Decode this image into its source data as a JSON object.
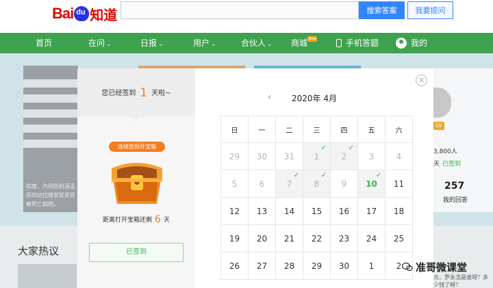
{
  "header": {
    "logo_text": "Bai",
    "logo_paw": "du",
    "logo_cn": "知道",
    "search_button": "搜索答案",
    "ask_button": "我要提问"
  },
  "nav": {
    "items": [
      "首页",
      "在问",
      "日报",
      "用户",
      "合伙人",
      "商城",
      "手机答题",
      "我的"
    ],
    "new_tag": "New"
  },
  "background": {
    "news_snippet": "印度，为何危机诬孟买的达拉维贫民贫民窟死亡病例。",
    "profile_level": "LV",
    "fans": "3,800人",
    "days_label": "天",
    "days_signed": "已签到",
    "answer_count": "257",
    "answer_label": "我的回答",
    "hot_title": "大家热议",
    "bottom_snippet": "元，罗永浩是谁呀？多少钱了呀？"
  },
  "modal": {
    "streak_prefix": "您已经签到",
    "streak_days": "1",
    "streak_suffix": "天啦~",
    "chest_badge": "连续签到开宝箱",
    "remain_prefix": "距离打开宝箱还剩",
    "remain_days": "6",
    "remain_suffix": "天",
    "signed_button": "已签到",
    "close": "×",
    "prev_arrow": "‹",
    "month": "2020年 4月"
  },
  "calendar": {
    "weekdays": [
      "日",
      "一",
      "二",
      "三",
      "四",
      "五",
      "六"
    ],
    "rows": [
      [
        {
          "d": "29",
          "t": "other"
        },
        {
          "d": "30",
          "t": "other"
        },
        {
          "d": "31",
          "t": "other"
        },
        {
          "d": "1",
          "t": "other",
          "signed": true
        },
        {
          "d": "2",
          "t": "other",
          "signed": true
        },
        {
          "d": "3",
          "t": "other"
        },
        {
          "d": "4",
          "t": "other"
        }
      ],
      [
        {
          "d": "5",
          "t": "other"
        },
        {
          "d": "6",
          "t": "other"
        },
        {
          "d": "7",
          "t": "other",
          "signed": true
        },
        {
          "d": "8",
          "t": "other",
          "signed": true
        },
        {
          "d": "9",
          "t": "other"
        },
        {
          "d": "10",
          "t": "today",
          "signed": true
        },
        {
          "d": "11",
          "t": "cur"
        }
      ],
      [
        {
          "d": "12",
          "t": "cur"
        },
        {
          "d": "13",
          "t": "cur"
        },
        {
          "d": "14",
          "t": "cur"
        },
        {
          "d": "15",
          "t": "cur"
        },
        {
          "d": "16",
          "t": "cur"
        },
        {
          "d": "17",
          "t": "cur"
        },
        {
          "d": "18",
          "t": "cur"
        }
      ],
      [
        {
          "d": "19",
          "t": "cur"
        },
        {
          "d": "20",
          "t": "cur"
        },
        {
          "d": "21",
          "t": "cur"
        },
        {
          "d": "22",
          "t": "cur"
        },
        {
          "d": "23",
          "t": "cur"
        },
        {
          "d": "24",
          "t": "cur"
        },
        {
          "d": "25",
          "t": "cur"
        }
      ],
      [
        {
          "d": "26",
          "t": "cur"
        },
        {
          "d": "27",
          "t": "cur"
        },
        {
          "d": "28",
          "t": "cur"
        },
        {
          "d": "29",
          "t": "cur"
        },
        {
          "d": "30",
          "t": "cur"
        },
        {
          "d": "1",
          "t": "cur"
        },
        {
          "d": "2",
          "t": "cur"
        }
      ]
    ],
    "check_glyph": "✓"
  },
  "watermark": "准哥微课堂",
  "colors": {
    "brand_green": "#3fa24f",
    "accent_orange": "#f57d1f",
    "signed_green": "#38b54a",
    "search_blue": "#3385ff"
  }
}
